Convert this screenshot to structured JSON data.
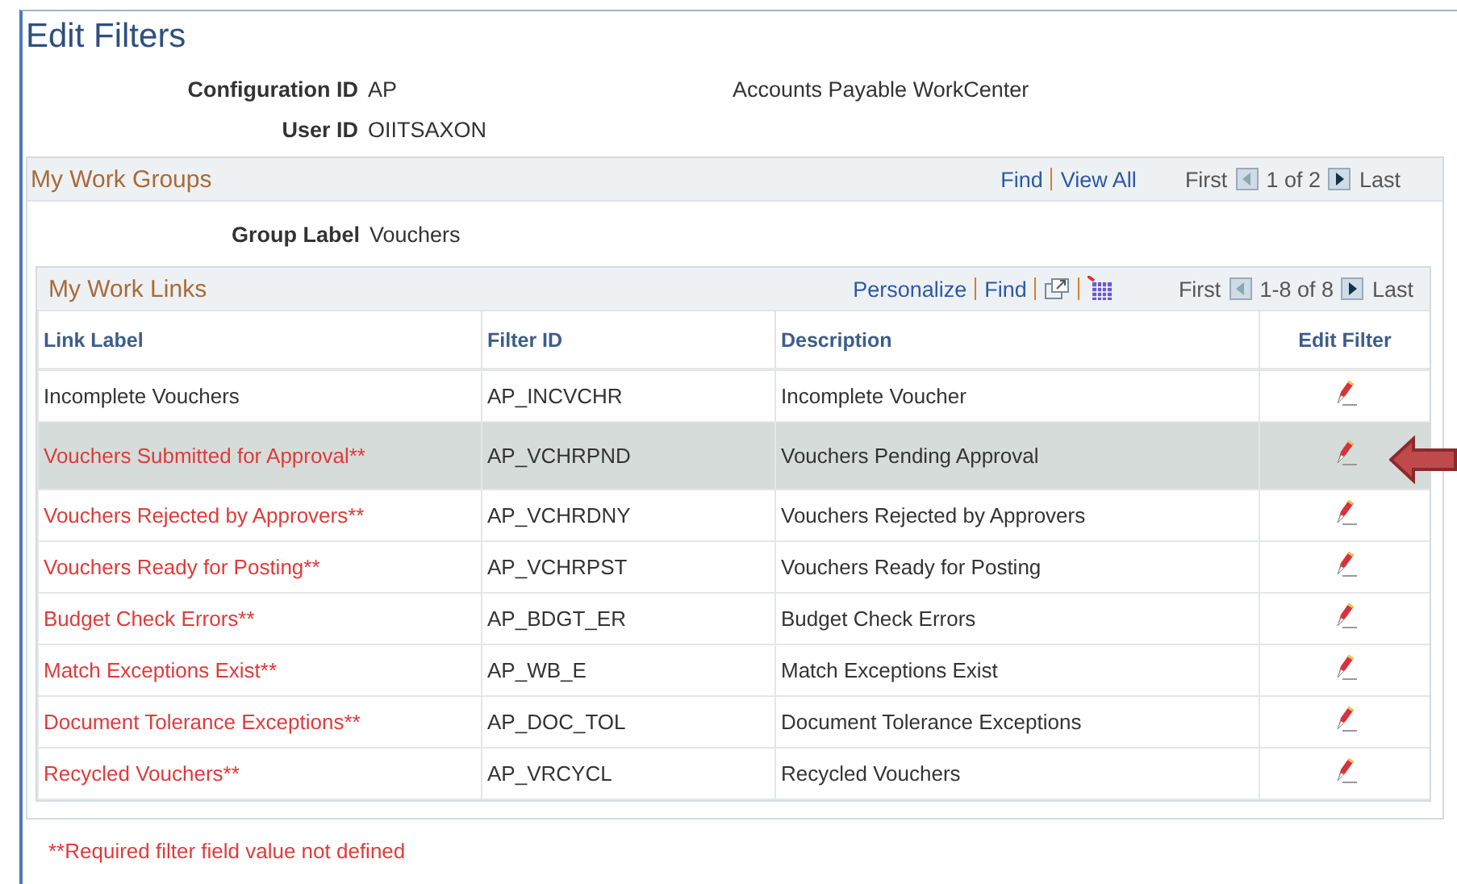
{
  "title": "Edit Filters",
  "fields": [
    {
      "label": "Configuration ID",
      "value": "AP",
      "note": "Accounts Payable WorkCenter"
    },
    {
      "label": "User ID",
      "value": "OIITSAXON"
    }
  ],
  "work_groups": {
    "title": "My Work Groups",
    "links": [
      "Find",
      "View All"
    ],
    "first": "First",
    "range": "1 of 2",
    "last": "Last",
    "group_label": {
      "label": "Group Label",
      "value": "Vouchers"
    },
    "work_links": {
      "title": "My Work Links",
      "links": [
        "Personalize",
        "Find"
      ],
      "first": "First",
      "range": "1-8 of 8",
      "last": "Last",
      "columns": [
        "Link Label",
        "Filter ID",
        "Description",
        "Edit Filter"
      ],
      "rows": [
        {
          "label": "Incomplete Vouchers",
          "filter_id": "AP_INCVCHR",
          "description": "Incomplete Voucher",
          "flagged": false,
          "selected": false
        },
        {
          "label": "Vouchers Submitted for Approval**",
          "filter_id": "AP_VCHRPND",
          "description": "Vouchers Pending Approval",
          "flagged": true,
          "selected": true
        },
        {
          "label": "Vouchers Rejected by Approvers**",
          "filter_id": "AP_VCHRDNY",
          "description": "Vouchers Rejected by Approvers",
          "flagged": true,
          "selected": false
        },
        {
          "label": "Vouchers Ready for Posting**",
          "filter_id": "AP_VCHRPST",
          "description": "Vouchers Ready for Posting",
          "flagged": true,
          "selected": false
        },
        {
          "label": "Budget Check Errors**",
          "filter_id": "AP_BDGT_ER",
          "description": "Budget Check Errors",
          "flagged": true,
          "selected": false
        },
        {
          "label": "Match Exceptions Exist**",
          "filter_id": "AP_WB_E",
          "description": "Match Exceptions Exist",
          "flagged": true,
          "selected": false
        },
        {
          "label": "Document Tolerance Exceptions**",
          "filter_id": "AP_DOC_TOL",
          "description": "Document Tolerance Exceptions",
          "flagged": true,
          "selected": false
        },
        {
          "label": "Recycled Vouchers**",
          "filter_id": "AP_VRCYCL",
          "description": "Recycled Vouchers",
          "flagged": true,
          "selected": false
        }
      ]
    }
  },
  "footnote": "**Required filter field value not defined"
}
